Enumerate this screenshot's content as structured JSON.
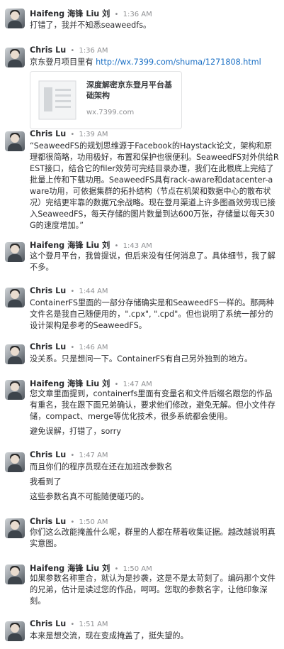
{
  "messages": [
    {
      "name": "Haifeng 海锋 Liu 刘",
      "time": "1:36 AM",
      "lines": [
        "打错了，我并不知悉seaweedfs。"
      ]
    },
    {
      "name": "Chris Lu",
      "time": "1:36 AM",
      "text_prefix": "京东登月项目里有 ",
      "link": "http://wx.7399.com/shuma/1271808.html",
      "card": {
        "title": "深度解密京东登月平台基础架构",
        "url": "wx.7399.com",
        "thumb_icon": "document-thumbnail-icon"
      }
    },
    {
      "name": "Chris Lu",
      "time": "1:39 AM",
      "lines": [
        "“SeaweedFS的规划思维源于Facebook的Haystack论文，架构和原理都很简略，功用极好，布置和保护也很便利。SeaweedFS对外供给REST接口，结合它的filer效劳可完结目录办理，我们在此根底上完结了批量上传和下载功用。SeaweedFS具有rack-aware和datacenter-aware功用，可依据集群的拓扑结构（节点在机架和数据中心的散布状况）完结更牢靠的数据冗余战略。现在登月渠道上许多图画效劳现已接入SeaweedFS，每天存储的图片数量到达600万张，存储量以每天30G的速度增加。”"
      ]
    },
    {
      "name": "Haifeng 海锋 Liu 刘",
      "time": "1:43 AM",
      "lines": [
        "这个登月平台，我曾提说，但后来没有任何消息了。具体细节，我了解不多。"
      ]
    },
    {
      "name": "Chris Lu",
      "time": "1:44 AM",
      "lines": [
        "ContainerFS里面的一部分存储确实是和SeaweedFS一样的。那两种文件名是我自己随便用的，\".cpx\", \".cpd\"。但也说明了系统一部分的设计架构是参考的SeaweedFS。"
      ]
    },
    {
      "name": "Chris Lu",
      "time": "1:46 AM",
      "lines": [
        "没关系。只是想问一下。ContainerFS有自己另外独到的地方。"
      ]
    },
    {
      "name": "Haifeng 海锋 Liu 刘",
      "time": "1:47 AM",
      "lines": [
        "您文章里面提到，containerfs里面有变量名和文件后缀名跟您的作品有重名，我在跟下面兄弟确认，要求他们修改，避免无解。但小文件存储，compact、merge等优化技术，很多系统都会使用。",
        "避免误解，打错了，sorry"
      ]
    },
    {
      "name": "Chris Lu",
      "time": "1:47 AM",
      "lines": [
        "而且你们的程序员现在还在加班改参数名",
        "我看到了",
        "这些参数名真不可能随便碰巧的。"
      ]
    },
    {
      "name": "Chris Lu",
      "time": "1:50 AM",
      "lines": [
        "你们这么改能掩盖什么呢，群里的人都在帮着收集证据。越改越说明真实意图。"
      ]
    },
    {
      "name": "Haifeng 海锋 Liu 刘",
      "time": "1:50 AM",
      "lines": [
        "如果参数名称重合，就认为是抄袭，这是不是太苛刻了。编码那个文件的兄弟，估计是读过您的作品，呵呵。您取的参数名字，让他印象深刻。"
      ]
    },
    {
      "name": "Chris Lu",
      "time": "1:51 AM",
      "lines": [
        "本来是想交流，现在变成掩盖了，挺失望的。"
      ]
    }
  ]
}
